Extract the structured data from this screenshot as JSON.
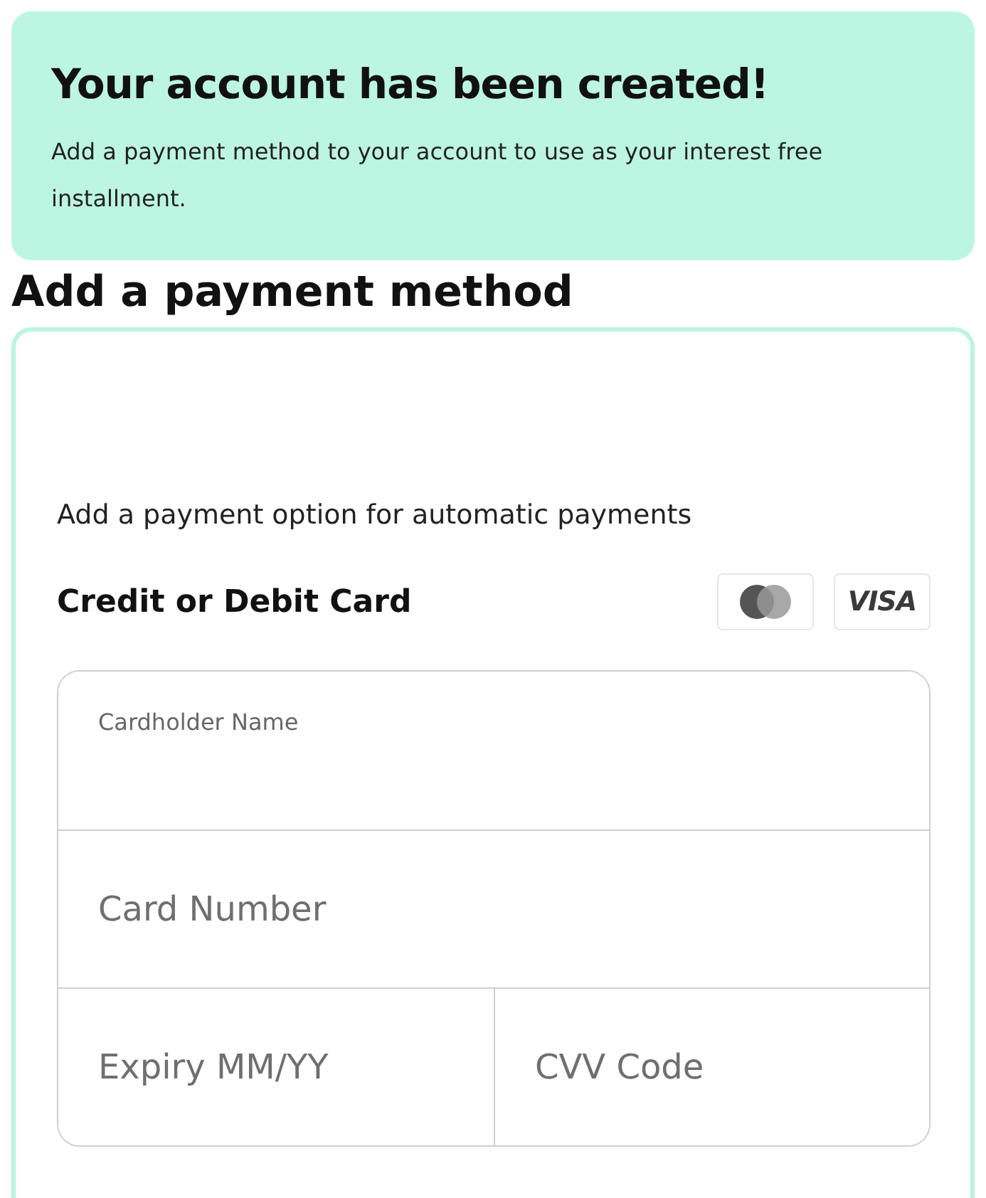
{
  "toast": {
    "title": "Your account has been created!",
    "message": "Add a payment method to your account to use as your interest free installment."
  },
  "heading": "Add a payment method",
  "card": {
    "intro": "Add a payment option for automatic payments",
    "section_title": "Credit or Debit Card",
    "brands": [
      {
        "kind": "mastercard"
      },
      {
        "kind": "visa",
        "label": "VISA"
      }
    ],
    "fields": [
      {
        "label": "Cardholder Name"
      },
      {
        "placeholder": "Card Number"
      },
      {
        "placeholder": "Expiry MM/YY"
      },
      {
        "placeholder": "CVV Code"
      }
    ]
  }
}
